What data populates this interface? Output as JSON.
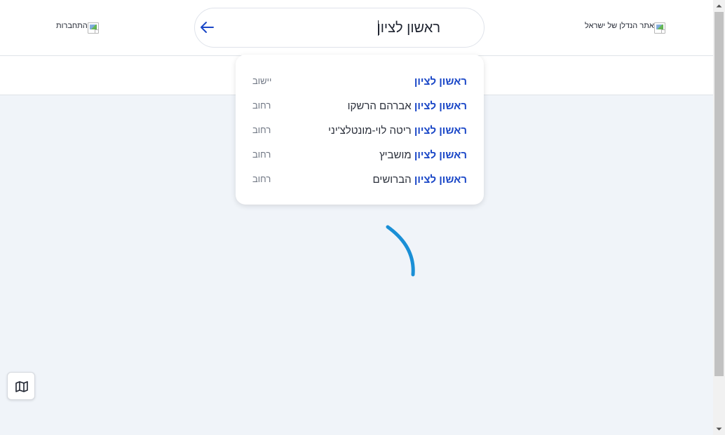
{
  "header": {
    "logo_alt": "אתר הנדלן של ישראל",
    "login_alt": "התחברות"
  },
  "search": {
    "value": "ראשון לציון",
    "back_icon": "arrow-left-icon"
  },
  "suggestions": [
    {
      "match": "ראשון לציון",
      "rest": "",
      "type": "יישוב"
    },
    {
      "match": "ראשון לציון",
      "rest": " אברהם הרשקו",
      "type": "רחוב"
    },
    {
      "match": "ראשון לציון",
      "rest": " ריטה לוי-מונטלצ'יני",
      "type": "רחוב"
    },
    {
      "match": "ראשון לציון",
      "rest": " מושביץ",
      "type": "רחוב"
    },
    {
      "match": "ראשון לציון",
      "rest": " הברושים",
      "type": "רחוב"
    }
  ],
  "colors": {
    "accent": "#1a47c7",
    "spinner": "#1a8fd6",
    "background": "#f0f4f9"
  },
  "map_button": {
    "icon": "map-icon"
  }
}
